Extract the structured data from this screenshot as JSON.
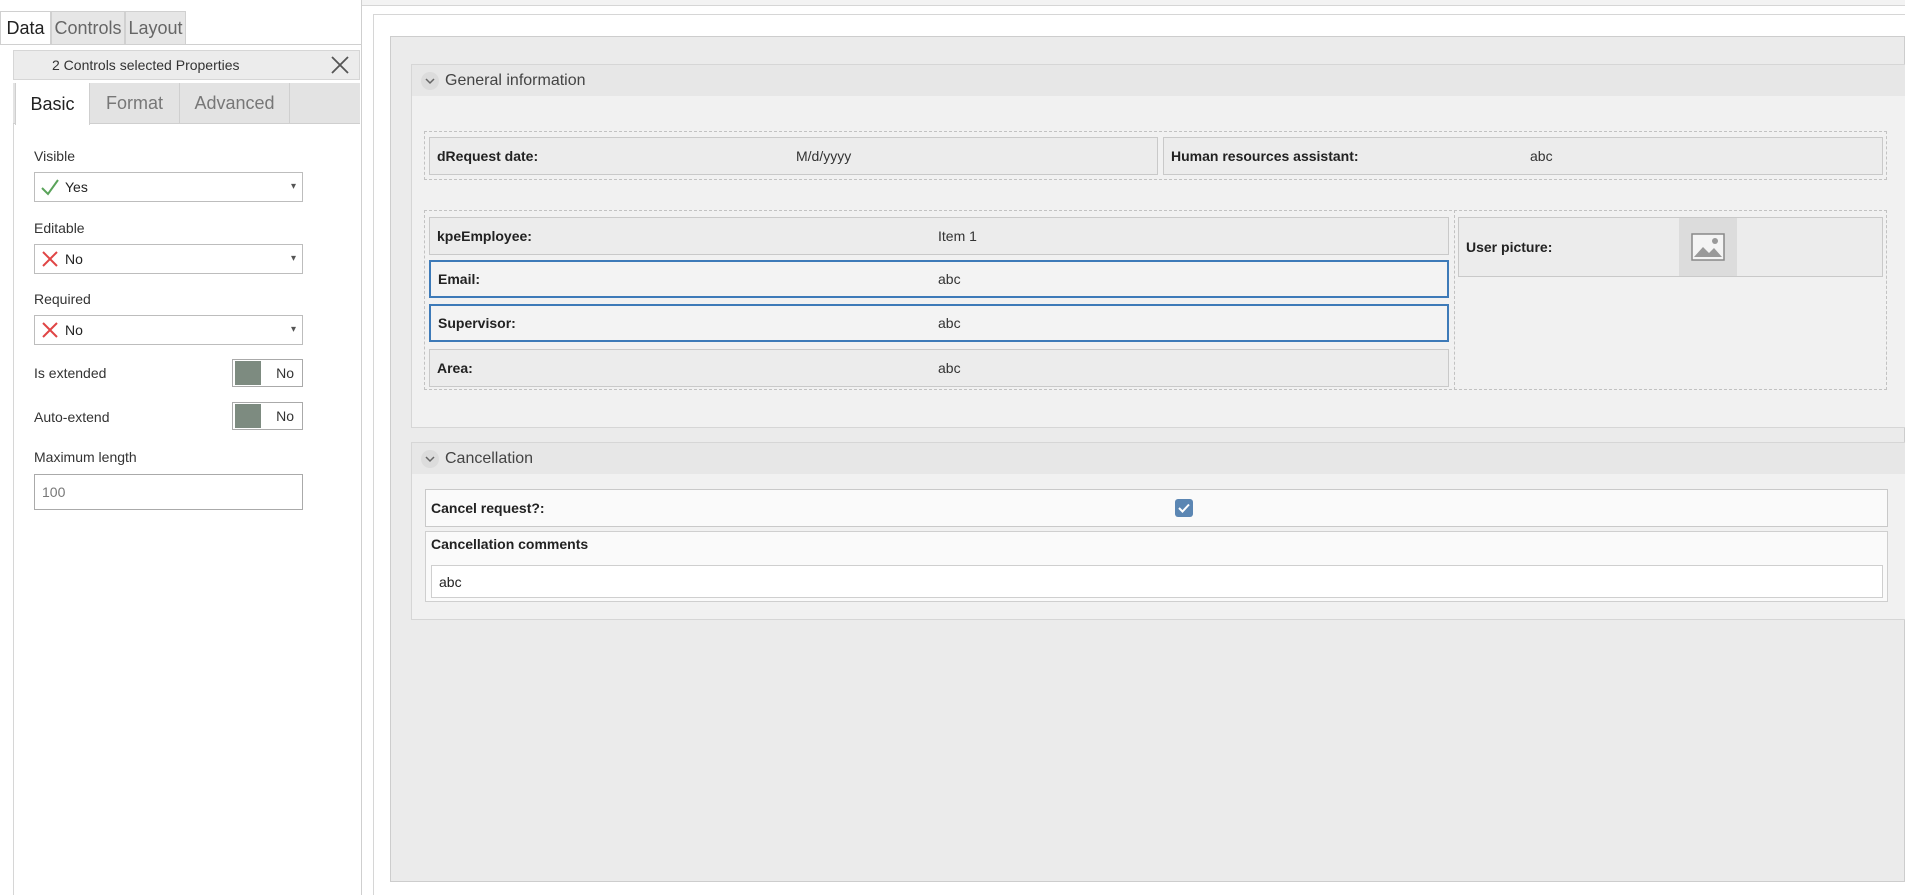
{
  "panel": {
    "tabs": [
      "Data",
      "Controls",
      "Layout"
    ],
    "header": "2 Controls selected Properties",
    "subtabs": [
      "Basic",
      "Format",
      "Advanced"
    ],
    "visible": {
      "label": "Visible",
      "value": "Yes",
      "icon": "check-icon"
    },
    "editable": {
      "label": "Editable",
      "value": "No",
      "icon": "x-icon"
    },
    "required": {
      "label": "Required",
      "value": "No",
      "icon": "x-icon"
    },
    "is_extended": {
      "label": "Is extended",
      "value": "No"
    },
    "auto_extend": {
      "label": "Auto-extend",
      "value": "No"
    },
    "max_length": {
      "label": "Maximum length",
      "value": "100"
    }
  },
  "form": {
    "general": {
      "title": "General information",
      "request_date": {
        "label": "dRequest date:",
        "value": "M/d/yyyy"
      },
      "hr_assistant": {
        "label": "Human resources assistant:",
        "value": "abc"
      },
      "employee": {
        "label": "kpeEmployee:",
        "value": "Item 1"
      },
      "email": {
        "label": "Email:",
        "value": "abc"
      },
      "supervisor": {
        "label": "Supervisor:",
        "value": "abc"
      },
      "area": {
        "label": "Area:",
        "value": "abc"
      },
      "user_picture": {
        "label": "User picture:"
      }
    },
    "cancellation": {
      "title": "Cancellation",
      "cancel_request": {
        "label": "Cancel request?:",
        "checked": true
      },
      "comments": {
        "label": "Cancellation comments",
        "value": "abc"
      }
    }
  },
  "colors": {
    "selection": "#3d7ab8",
    "toggle_knob": "#7d8b80",
    "checkbox": "#5b86b3"
  }
}
